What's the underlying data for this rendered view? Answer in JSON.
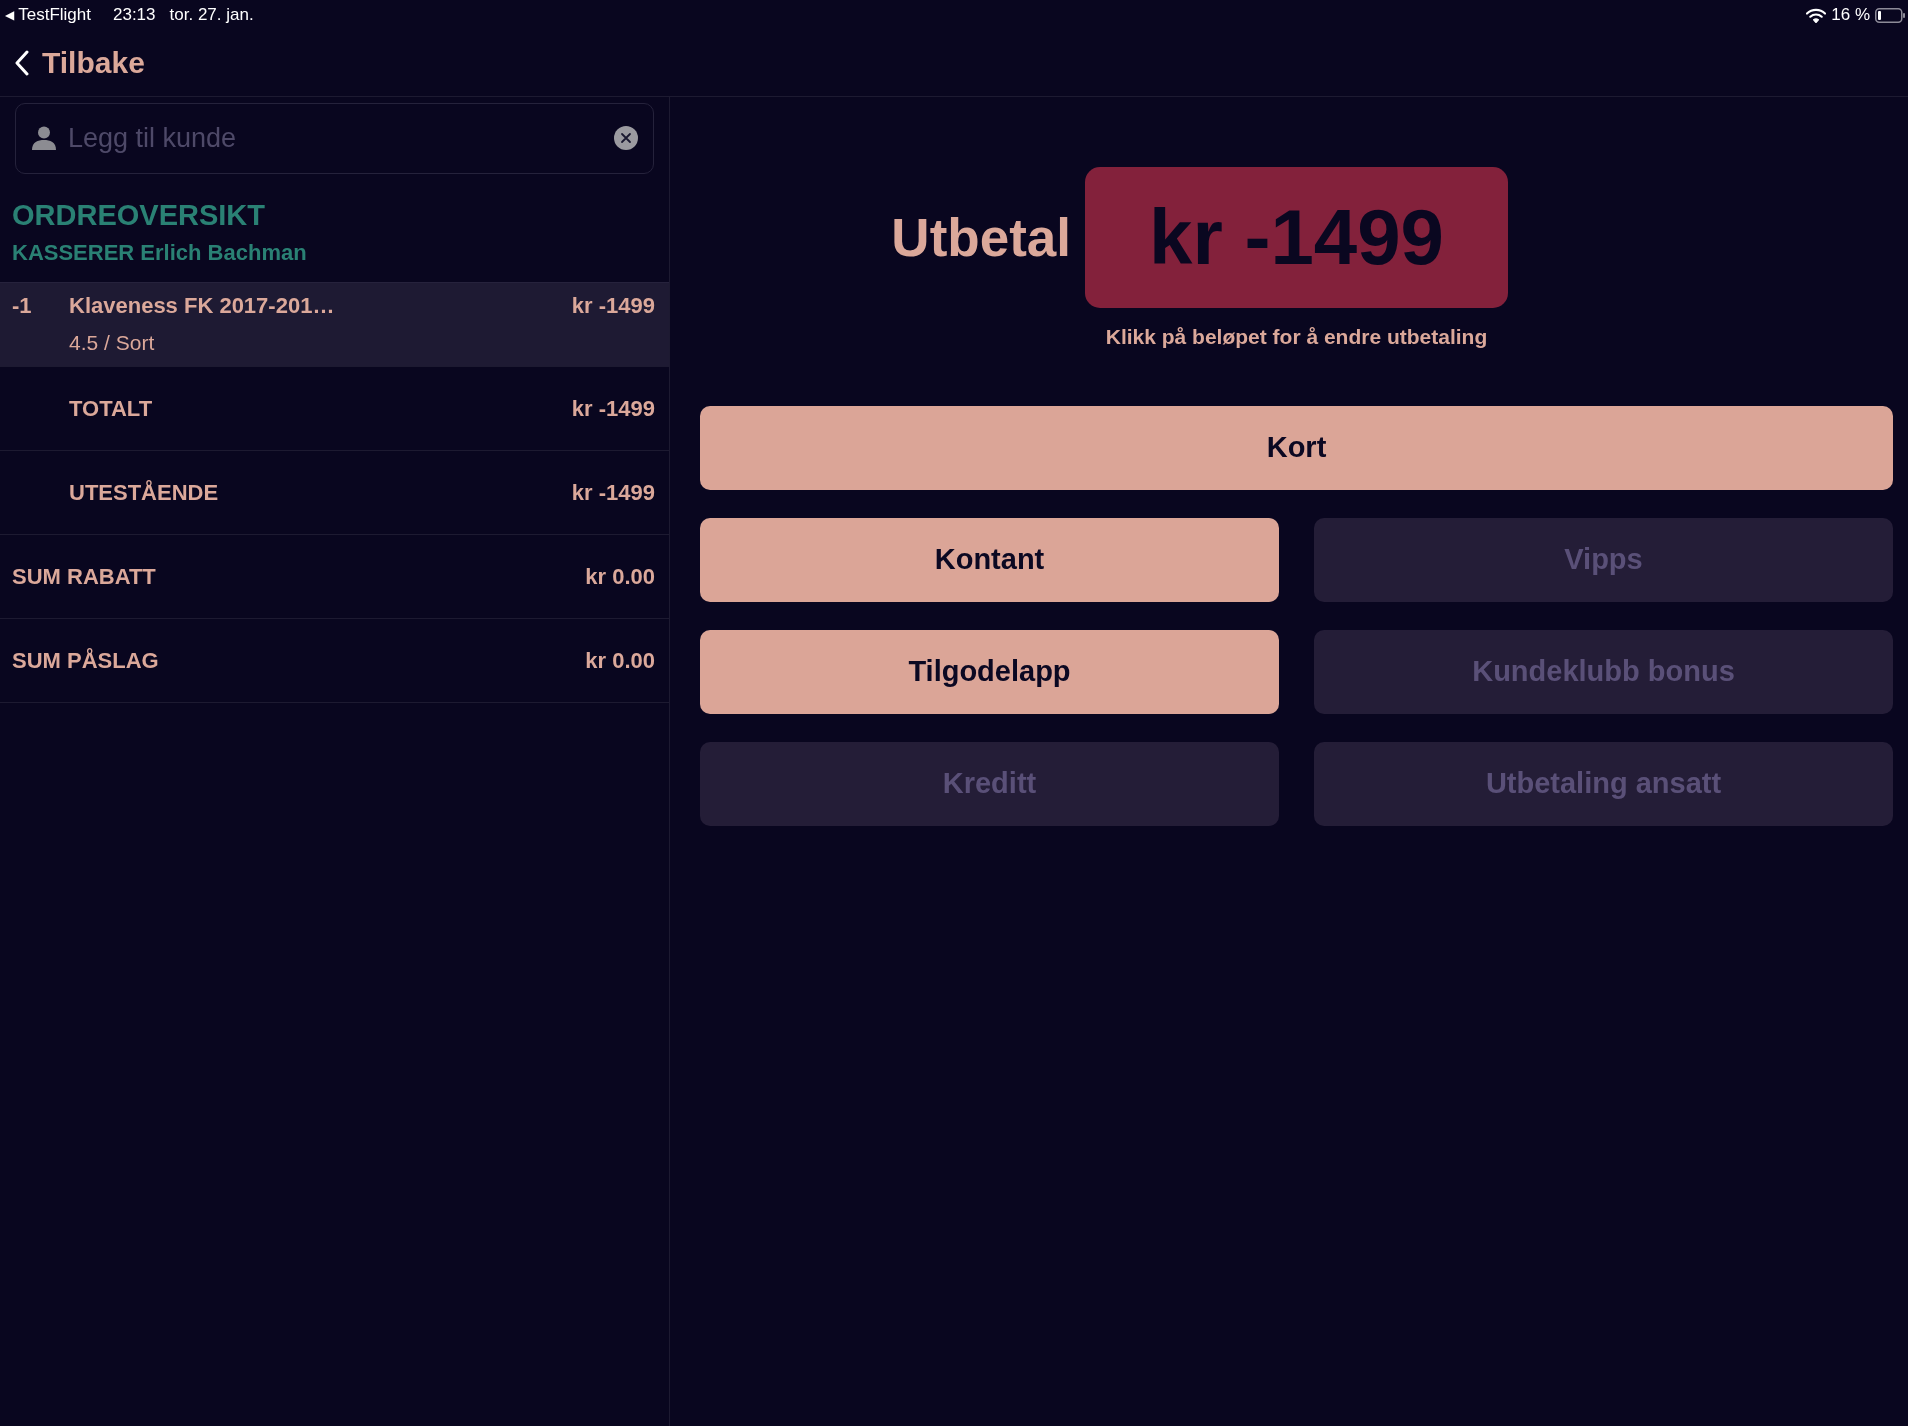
{
  "status_bar": {
    "back_glyph": "◀",
    "back_app": "TestFlight",
    "time": "23:13",
    "date": "tor. 27. jan.",
    "battery_percent": "16 %"
  },
  "nav": {
    "back_label": "Tilbake"
  },
  "customer_field": {
    "placeholder": "Legg til kunde"
  },
  "order": {
    "title": "ORDREOVERSIKT",
    "cashier": "KASSERER Erlich Bachman",
    "lines": [
      {
        "quantity": "-1",
        "name": "Klaveness FK 2017-201…",
        "variant": "4.5 / Sort",
        "price": "kr -1499",
        "selected": true
      }
    ],
    "totals": [
      {
        "kind": "subtotal",
        "label": "TOTALT",
        "amount": "kr -1499"
      },
      {
        "kind": "subtotal",
        "label": "UTESTÅENDE",
        "amount": "kr -1499"
      },
      {
        "kind": "summary",
        "label": "SUM RABATT",
        "amount": "kr 0.00"
      },
      {
        "kind": "summary",
        "label": "SUM PÅSLAG",
        "amount": "kr 0.00"
      }
    ]
  },
  "payout": {
    "label": "Utbetal",
    "amount": "kr -1499",
    "hint": "Klikk på beløpet for å endre utbetaling"
  },
  "payment_methods": [
    {
      "kind": "wide",
      "label": "Kort",
      "disabled": false
    },
    {
      "kind": "half",
      "label": "Kontant",
      "disabled": false
    },
    {
      "kind": "half",
      "label": "Vipps",
      "disabled": true
    },
    {
      "kind": "half",
      "label": "Tilgodelapp",
      "disabled": false
    },
    {
      "kind": "half",
      "label": "Kundeklubb bonus",
      "disabled": true
    },
    {
      "kind": "half",
      "label": "Kreditt",
      "disabled": true
    },
    {
      "kind": "half",
      "label": "Utbetaling ansatt",
      "disabled": true
    }
  ]
}
